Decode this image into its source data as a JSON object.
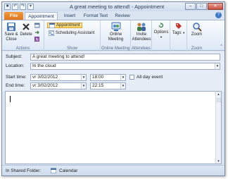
{
  "window": {
    "title": "A great meeting to attend! - Appointment",
    "minimize_glyph": "–",
    "maximize_glyph": "□",
    "close_glyph": "✕"
  },
  "quick_access": {
    "save_glyph": "■",
    "undo_glyph": "↶",
    "redo_glyph": "↷",
    "more_glyph": "▾"
  },
  "tabs": [
    {
      "label": "File"
    },
    {
      "label": "Appointment"
    },
    {
      "label": "Insert"
    },
    {
      "label": "Format Text"
    },
    {
      "label": "Review"
    }
  ],
  "help_glyph": "?",
  "ribbon": {
    "actions": {
      "label": "Actions",
      "save_close": "Save & Close",
      "delete": "Delete"
    },
    "show": {
      "label": "Show",
      "appointment": "Appointment",
      "scheduling_assistant": "Scheduling Assistant"
    },
    "online_meeting": {
      "label": "Online Meeting",
      "button": "Online Meeting"
    },
    "attendees": {
      "label": "Attendees",
      "invite": "Invite Attendees"
    },
    "options": {
      "button": "Options"
    },
    "tags": {
      "button": "Tags"
    },
    "zoom": {
      "label": "Zoom",
      "button": "Zoom"
    },
    "collapse_glyph": "^"
  },
  "form": {
    "subject_label": "Subject:",
    "subject_value": "A great meeting to attend!",
    "location_label": "Location:",
    "location_value": "In the cloud",
    "start_label": "Start time:",
    "start_date": "vr 3/02/2012",
    "start_time": "18:00",
    "end_label": "End time:",
    "end_date": "vr 3/02/2012",
    "end_time": "22:15",
    "all_day_label": "All day event",
    "dropdown_glyph": "▼"
  },
  "scroll": {
    "up_glyph": "▲",
    "down_glyph": "▼"
  },
  "status": {
    "shared_folder_label": "In Shared Folder:",
    "calendar": "Calendar"
  },
  "colors": {
    "file_tab": "#e0731a",
    "ribbon_highlight": "#ffd25c",
    "accent": "#3d78c9"
  }
}
